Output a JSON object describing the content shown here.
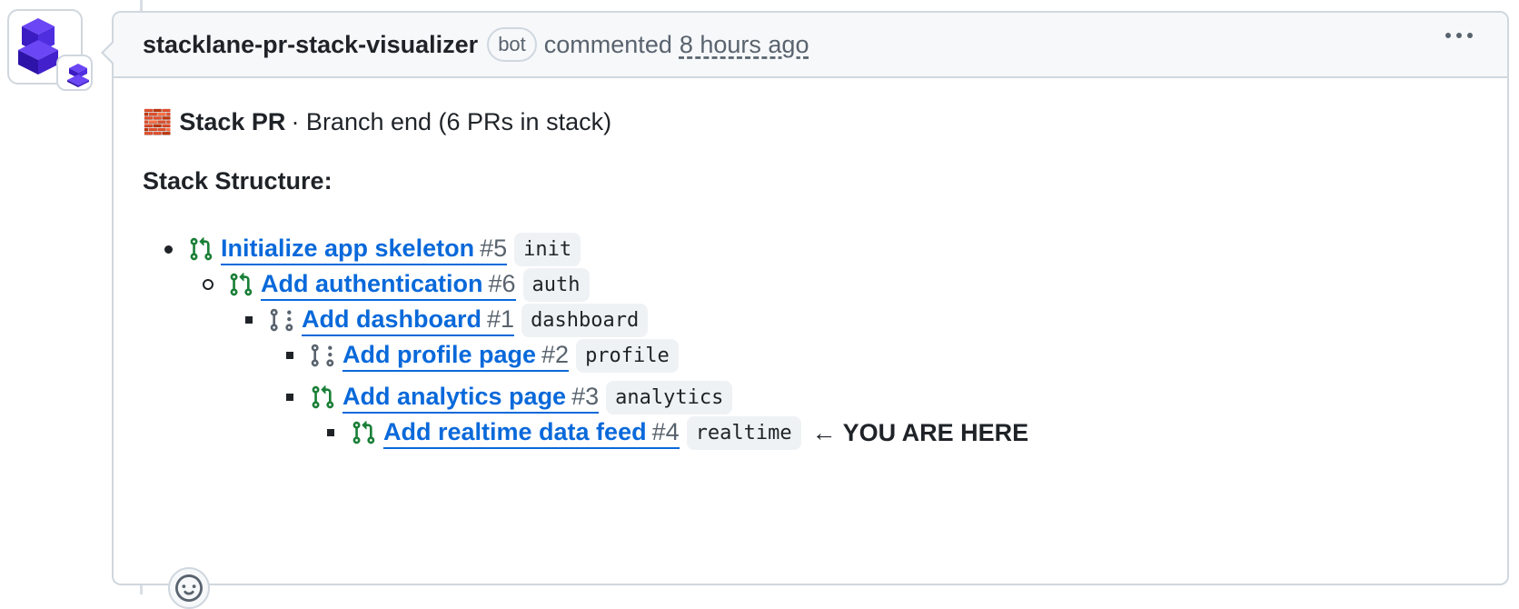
{
  "comment": {
    "author": "stacklane-pr-stack-visualizer",
    "badge": "bot",
    "action": "commented",
    "timestamp": "8 hours ago"
  },
  "body": {
    "intro_emoji": "🧱",
    "intro_strong": "Stack PR",
    "intro_rest": "· Branch end (6 PRs in stack)",
    "heading": "Stack Structure:",
    "items": [
      {
        "title": "Initialize app skeleton",
        "number": "#5",
        "branch": "init",
        "status_icon": "git-pull-request-merged-icon"
      },
      {
        "title": "Add authentication",
        "number": "#6",
        "branch": "auth",
        "status_icon": "git-pull-request-merged-icon"
      },
      {
        "title": "Add dashboard",
        "number": "#1",
        "branch": "dashboard",
        "status_icon": "git-pull-request-draft-icon"
      },
      {
        "title": "Add profile page",
        "number": "#2",
        "branch": "profile",
        "status_icon": "git-pull-request-draft-icon"
      },
      {
        "title": "Add analytics page",
        "number": "#3",
        "branch": "analytics",
        "status_icon": "git-pull-request-merged-icon"
      },
      {
        "title": "Add realtime data feed",
        "number": "#4",
        "branch": "realtime",
        "status_icon": "git-pull-request-merged-icon",
        "marker": "← YOU ARE HERE"
      }
    ]
  },
  "colors": {
    "link": "#0969da",
    "merged_icon": "#1a7f37",
    "draft_icon": "#59636e",
    "border": "#d0d7de",
    "header_bg": "#f6f8fa",
    "avatar_primary": "#5b2bd9"
  }
}
